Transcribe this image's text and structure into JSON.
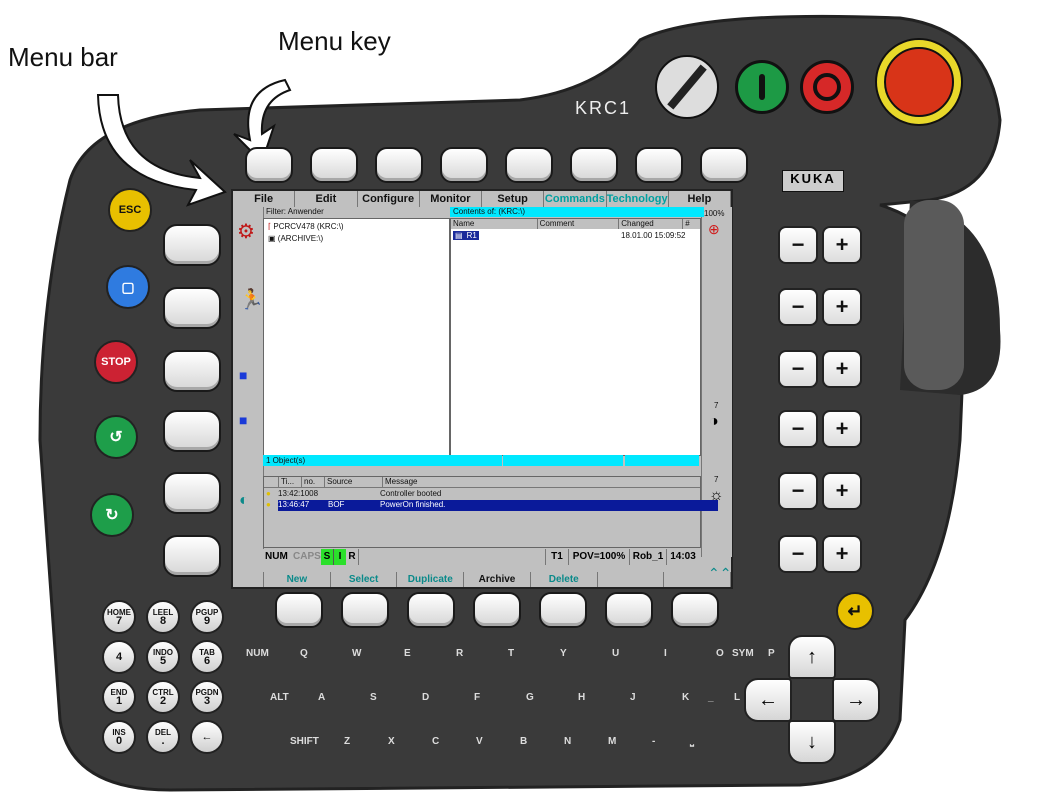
{
  "annotations": {
    "menu_bar": "Menu bar",
    "menu_key": "Menu key"
  },
  "device": {
    "label": "KRC1",
    "kuka_logo": "KUKA"
  },
  "menu": [
    "File",
    "Edit",
    "Configure",
    "Monitor",
    "Setup",
    "Commands",
    "Technology",
    "Help"
  ],
  "filter": "Filter: Anwender",
  "contents_of": "Contents of: (KRC:\\)",
  "tree": [
    "PCRCV478 (KRC:\\)",
    "(ARCHIVE:\\)"
  ],
  "file_columns": [
    "Name",
    "Comment",
    "Changed",
    "#"
  ],
  "file_row": {
    "name": "R1",
    "changed": "18.01.00 15:09:52"
  },
  "objects": "1 Object(s)",
  "msg_columns": [
    "Ti...",
    "no.",
    "Source",
    "Message"
  ],
  "messages": [
    {
      "time": "13:42:1008",
      "source": "",
      "message": "Controller booted"
    },
    {
      "time": "13:46:47",
      "source": "BOF",
      "message": "PowerOn finished."
    }
  ],
  "status": {
    "num": "NUM",
    "caps": "CAPS",
    "s": "S",
    "i": "I",
    "r": "R",
    "mode": "T1",
    "pov": "POV=100%",
    "rob": "Rob_1",
    "time": "14:03"
  },
  "softkeys": [
    "New",
    "Select",
    "Duplicate",
    "Archive",
    "Delete"
  ],
  "right_status": {
    "percent": "100%",
    "seven": "7"
  },
  "left_buttons": [
    "ESC",
    "",
    "STOP",
    "",
    ""
  ],
  "numpad": [
    {
      "top": "HOME",
      "num": "7"
    },
    {
      "top": "LEEL",
      "num": "8"
    },
    {
      "top": "PGUP",
      "num": "9"
    },
    {
      "top": "",
      "num": "4"
    },
    {
      "top": "INDO",
      "num": "5"
    },
    {
      "top": "TAB",
      "num": "6"
    },
    {
      "top": "END",
      "num": "1"
    },
    {
      "top": "CTRL",
      "num": "2"
    },
    {
      "top": "PGDN",
      "num": "3"
    },
    {
      "top": "INS",
      "num": "0"
    },
    {
      "top": "DEL",
      "num": "."
    },
    {
      "top": "",
      "num": "←"
    }
  ],
  "alpha_rows": [
    [
      "NUM",
      "Q",
      "W",
      "E",
      "R",
      "T",
      "Y",
      "U",
      "I",
      "O",
      "P",
      "SYM"
    ],
    [
      "ALT",
      "A",
      "S",
      "D",
      "F",
      "G",
      "H",
      "J",
      "K",
      "L",
      "_"
    ],
    [
      "SHIFT",
      "Z",
      "X",
      "C",
      "V",
      "B",
      "N",
      "M",
      "-",
      "⎵"
    ]
  ],
  "plus": "+",
  "minus": "−",
  "arrows": {
    "up": "↑",
    "down": "↓",
    "left": "←",
    "right": "→"
  },
  "enter": "↵",
  "colors": {
    "body": "#3d3d3d",
    "cyan": "#00e8ff",
    "esc": "#e8c000",
    "blue": "#2f7be0",
    "stop": "#cc2233",
    "green": "#1e9e4a",
    "estop": "#d83418"
  }
}
